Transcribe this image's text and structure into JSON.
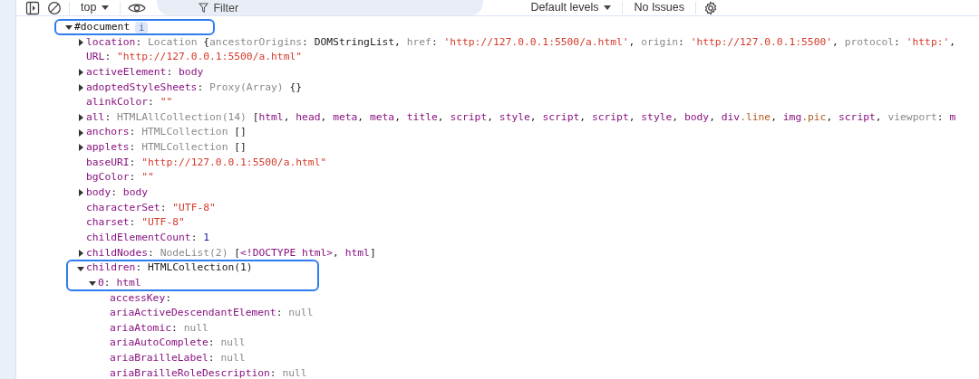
{
  "toolbar": {
    "context": "top",
    "filter": {
      "placeholder": "Filter"
    },
    "levels": "Default levels",
    "issues": "No Issues"
  },
  "tree": [
    {
      "tokens": [
        {
          "text": "#document",
          "kind": "node"
        }
      ],
      "badge": "i",
      "expanded": true,
      "highlighted": true,
      "children": [
        {
          "expanded": false,
          "tokens": [
            {
              "text": "location",
              "kind": "key"
            },
            {
              "text": ": ",
              "kind": "plain"
            },
            {
              "text": "Location ",
              "kind": "dim"
            },
            {
              "text": "{",
              "kind": "plain"
            },
            {
              "text": "ancestorOrigins",
              "kind": "dim"
            },
            {
              "text": ": DOMStringList, ",
              "kind": "plain"
            },
            {
              "text": "href",
              "kind": "dim"
            },
            {
              "text": ": ",
              "kind": "plain"
            },
            {
              "text": "'http://127.0.0.1:5500/a.html'",
              "kind": "str"
            },
            {
              "text": ", ",
              "kind": "plain"
            },
            {
              "text": "origin",
              "kind": "dim"
            },
            {
              "text": ": ",
              "kind": "plain"
            },
            {
              "text": "'http://127.0.0.1:5500'",
              "kind": "str"
            },
            {
              "text": ", ",
              "kind": "plain"
            },
            {
              "text": "protocol",
              "kind": "dim"
            },
            {
              "text": ": ",
              "kind": "plain"
            },
            {
              "text": "'http:'",
              "kind": "str"
            },
            {
              "text": ",",
              "kind": "plain"
            }
          ]
        },
        {
          "tokens": [
            {
              "text": "URL",
              "kind": "key"
            },
            {
              "text": ": ",
              "kind": "plain"
            },
            {
              "text": "\"http://127.0.0.1:5500/a.html\"",
              "kind": "str"
            }
          ]
        },
        {
          "expanded": false,
          "tokens": [
            {
              "text": "activeElement",
              "kind": "key"
            },
            {
              "text": ": ",
              "kind": "plain"
            },
            {
              "text": "body",
              "kind": "tag"
            }
          ]
        },
        {
          "expanded": false,
          "tokens": [
            {
              "text": "adoptedStyleSheets",
              "kind": "key"
            },
            {
              "text": ": ",
              "kind": "plain"
            },
            {
              "text": "Proxy(Array) ",
              "kind": "dim"
            },
            {
              "text": "{}",
              "kind": "plain"
            }
          ]
        },
        {
          "tokens": [
            {
              "text": "alinkColor",
              "kind": "key"
            },
            {
              "text": ": ",
              "kind": "plain"
            },
            {
              "text": "\"\"",
              "kind": "str"
            }
          ]
        },
        {
          "expanded": false,
          "tokens": [
            {
              "text": "all",
              "kind": "key"
            },
            {
              "text": ": ",
              "kind": "plain"
            },
            {
              "text": "HTMLAllCollection(14) ",
              "kind": "dim"
            },
            {
              "text": "[",
              "kind": "plain"
            },
            {
              "text": "html",
              "kind": "tag"
            },
            {
              "text": ", ",
              "kind": "plain"
            },
            {
              "text": "head",
              "kind": "tag"
            },
            {
              "text": ", ",
              "kind": "plain"
            },
            {
              "text": "meta",
              "kind": "tag"
            },
            {
              "text": ", ",
              "kind": "plain"
            },
            {
              "text": "meta",
              "kind": "tag"
            },
            {
              "text": ", ",
              "kind": "plain"
            },
            {
              "text": "title",
              "kind": "tag"
            },
            {
              "text": ", ",
              "kind": "plain"
            },
            {
              "text": "script",
              "kind": "tag"
            },
            {
              "text": ", ",
              "kind": "plain"
            },
            {
              "text": "style",
              "kind": "tag"
            },
            {
              "text": ", ",
              "kind": "plain"
            },
            {
              "text": "script",
              "kind": "tag"
            },
            {
              "text": ", ",
              "kind": "plain"
            },
            {
              "text": "script",
              "kind": "tag"
            },
            {
              "text": ", ",
              "kind": "plain"
            },
            {
              "text": "style",
              "kind": "tag"
            },
            {
              "text": ", ",
              "kind": "plain"
            },
            {
              "text": "body",
              "kind": "tag"
            },
            {
              "text": ", ",
              "kind": "plain"
            },
            {
              "text": "div",
              "kind": "tag"
            },
            {
              "text": ".line",
              "kind": "cls"
            },
            {
              "text": ", ",
              "kind": "plain"
            },
            {
              "text": "img",
              "kind": "tag"
            },
            {
              "text": ".pic",
              "kind": "cls"
            },
            {
              "text": ", ",
              "kind": "plain"
            },
            {
              "text": "script",
              "kind": "tag"
            },
            {
              "text": ", ",
              "kind": "plain"
            },
            {
              "text": "viewport",
              "kind": "dim"
            },
            {
              "text": ": ",
              "kind": "plain"
            },
            {
              "text": "m",
              "kind": "tag"
            }
          ]
        },
        {
          "expanded": false,
          "tokens": [
            {
              "text": "anchors",
              "kind": "key"
            },
            {
              "text": ": ",
              "kind": "plain"
            },
            {
              "text": "HTMLCollection ",
              "kind": "dim"
            },
            {
              "text": "[]",
              "kind": "plain"
            }
          ]
        },
        {
          "expanded": false,
          "tokens": [
            {
              "text": "applets",
              "kind": "key"
            },
            {
              "text": ": ",
              "kind": "plain"
            },
            {
              "text": "HTMLCollection ",
              "kind": "dim"
            },
            {
              "text": "[]",
              "kind": "plain"
            }
          ]
        },
        {
          "tokens": [
            {
              "text": "baseURI",
              "kind": "key"
            },
            {
              "text": ": ",
              "kind": "plain"
            },
            {
              "text": "\"http://127.0.0.1:5500/a.html\"",
              "kind": "str"
            }
          ]
        },
        {
          "tokens": [
            {
              "text": "bgColor",
              "kind": "key"
            },
            {
              "text": ": ",
              "kind": "plain"
            },
            {
              "text": "\"\"",
              "kind": "str"
            }
          ]
        },
        {
          "expanded": false,
          "tokens": [
            {
              "text": "body",
              "kind": "key"
            },
            {
              "text": ": ",
              "kind": "plain"
            },
            {
              "text": "body",
              "kind": "tag"
            }
          ]
        },
        {
          "tokens": [
            {
              "text": "characterSet",
              "kind": "key"
            },
            {
              "text": ": ",
              "kind": "plain"
            },
            {
              "text": "\"UTF-8\"",
              "kind": "str"
            }
          ]
        },
        {
          "tokens": [
            {
              "text": "charset",
              "kind": "key"
            },
            {
              "text": ": ",
              "kind": "plain"
            },
            {
              "text": "\"UTF-8\"",
              "kind": "str"
            }
          ]
        },
        {
          "tokens": [
            {
              "text": "childElementCount",
              "kind": "key"
            },
            {
              "text": ": ",
              "kind": "plain"
            },
            {
              "text": "1",
              "kind": "num"
            }
          ]
        },
        {
          "expanded": false,
          "tokens": [
            {
              "text": "childNodes",
              "kind": "key"
            },
            {
              "text": ": ",
              "kind": "plain"
            },
            {
              "text": "NodeList(2) ",
              "kind": "dim"
            },
            {
              "text": "[",
              "kind": "plain"
            },
            {
              "text": "<!DOCTYPE html>",
              "kind": "tag"
            },
            {
              "text": ", ",
              "kind": "plain"
            },
            {
              "text": "html",
              "kind": "tag"
            },
            {
              "text": "]",
              "kind": "plain"
            }
          ]
        },
        {
          "expanded": true,
          "highlighted": true,
          "tokens": [
            {
              "text": "children",
              "kind": "key"
            },
            {
              "text": ": HTMLCollection(1)",
              "kind": "plain"
            }
          ],
          "children": [
            {
              "expanded": true,
              "highlighted": true,
              "tokens": [
                {
                  "text": "0",
                  "kind": "key"
                },
                {
                  "text": ": ",
                  "kind": "plain"
                },
                {
                  "text": "html",
                  "kind": "tag"
                }
              ],
              "children": [
                {
                  "tokens": [
                    {
                      "text": "accessKey",
                      "kind": "key"
                    },
                    {
                      "text": ":",
                      "kind": "plain"
                    }
                  ]
                },
                {
                  "tokens": [
                    {
                      "text": "ariaActiveDescendantElement",
                      "kind": "key"
                    },
                    {
                      "text": ": ",
                      "kind": "plain"
                    },
                    {
                      "text": "null",
                      "kind": "dim"
                    }
                  ]
                },
                {
                  "tokens": [
                    {
                      "text": "ariaAtomic",
                      "kind": "key"
                    },
                    {
                      "text": ": ",
                      "kind": "plain"
                    },
                    {
                      "text": "null",
                      "kind": "dim"
                    }
                  ]
                },
                {
                  "tokens": [
                    {
                      "text": "ariaAutoComplete",
                      "kind": "key"
                    },
                    {
                      "text": ": ",
                      "kind": "plain"
                    },
                    {
                      "text": "null",
                      "kind": "dim"
                    }
                  ]
                },
                {
                  "tokens": [
                    {
                      "text": "ariaBrailleLabel",
                      "kind": "key"
                    },
                    {
                      "text": ": ",
                      "kind": "plain"
                    },
                    {
                      "text": "null",
                      "kind": "dim"
                    }
                  ]
                },
                {
                  "tokens": [
                    {
                      "text": "ariaBrailleRoleDescription",
                      "kind": "key"
                    },
                    {
                      "text": ": ",
                      "kind": "plain"
                    },
                    {
                      "text": "null",
                      "kind": "dim"
                    }
                  ]
                }
              ]
            }
          ]
        }
      ]
    }
  ]
}
